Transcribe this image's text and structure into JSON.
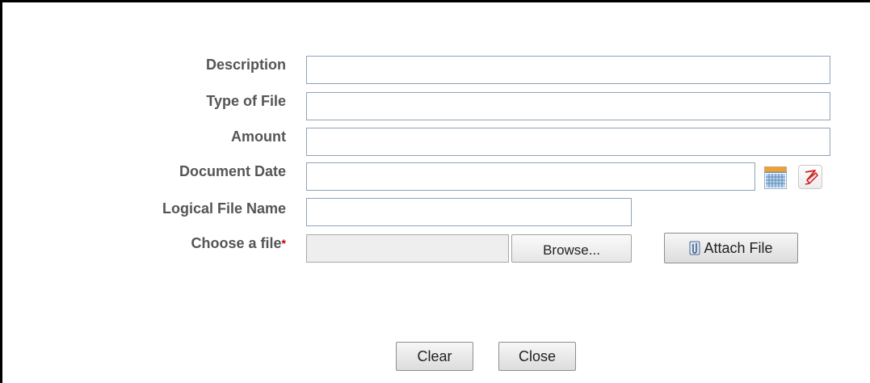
{
  "form": {
    "description_label": "Description",
    "type_of_file_label": "Type of File",
    "amount_label": "Amount",
    "document_date_label": "Document Date",
    "logical_file_name_label": "Logical File Name",
    "choose_file_label": "Choose a file",
    "required_marker": "*",
    "description_value": "",
    "type_of_file_value": "",
    "amount_value": "",
    "document_date_value": "",
    "logical_file_name_value": "",
    "chosen_file_value": ""
  },
  "buttons": {
    "browse": "Browse...",
    "attach_file": "Attach File",
    "clear": "Clear",
    "close": "Close"
  },
  "icons": {
    "calendar": "calendar-icon",
    "clear_date": "eraser-icon",
    "attach": "paperclip-icon"
  },
  "colors": {
    "label_text": "#555555",
    "required": "#c00000",
    "field_border": "#8fa3b7"
  }
}
